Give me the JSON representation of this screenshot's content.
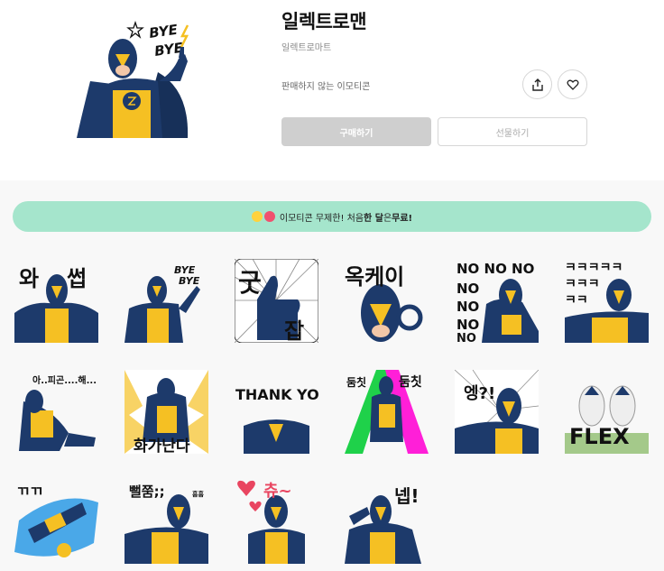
{
  "product": {
    "title": "일렉트로맨",
    "author": "일렉트로마트",
    "sale_status": "판매하지 않는 이모티콘",
    "hero_caption": [
      "BYE",
      "BYE"
    ]
  },
  "actions": {
    "buy_label": "구매하기",
    "gift_label": "선물하기",
    "share_icon": "share-icon",
    "like_icon": "heart-icon"
  },
  "promo": {
    "text_prefix": "이모티콘 무제한! 처음 ",
    "text_bold1": "한 달",
    "text_mid": "은 ",
    "text_bold2": "무료!"
  },
  "stickers": [
    {
      "caption": "와 썹"
    },
    {
      "caption": "BYE BYE"
    },
    {
      "caption": "굿 잡"
    },
    {
      "caption": "옥케이"
    },
    {
      "caption": "NO NO NO NO NO NO NO NO NO NO"
    },
    {
      "caption": "ㅋㅋㅋㅋㅋㅋㅋㅋㅋㅋㅋㅋ"
    },
    {
      "caption": "아..피곤....해..."
    },
    {
      "caption": "화가난다"
    },
    {
      "caption": "THANK YOU"
    },
    {
      "caption": "둠칫 둠칫"
    },
    {
      "caption": "엥?!"
    },
    {
      "caption": "FLEX"
    },
    {
      "caption": "ㄲㄲ"
    },
    {
      "caption": "뻘쭘;; 흠흠"
    },
    {
      "caption": "츄~"
    },
    {
      "caption": "넵!"
    }
  ],
  "colors": {
    "hero_navy": "#1d3a6b",
    "hero_yellow": "#f5c023",
    "promo_bg": "#a5e5cc",
    "buy_bg": "#cfcfcf"
  }
}
